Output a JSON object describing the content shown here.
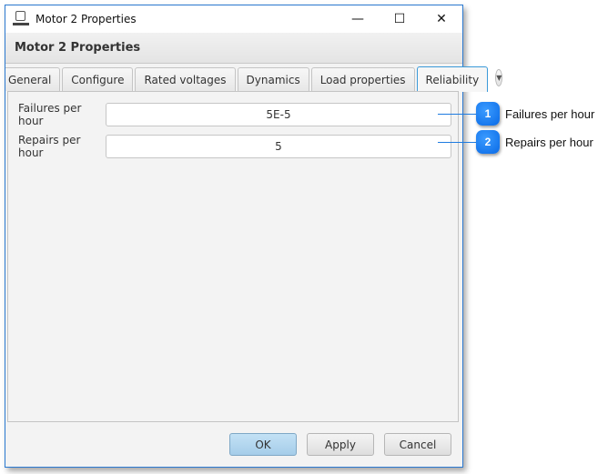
{
  "window": {
    "title": "Motor 2 Properties",
    "controls": {
      "minimize": "—",
      "maximize": "☐",
      "close": "✕"
    }
  },
  "header": {
    "title": "Motor 2 Properties"
  },
  "tabs": [
    {
      "label": "General",
      "active": false
    },
    {
      "label": "Configure",
      "active": false
    },
    {
      "label": "Rated voltages",
      "active": false
    },
    {
      "label": "Dynamics",
      "active": false
    },
    {
      "label": "Load properties",
      "active": false
    },
    {
      "label": "Reliability",
      "active": true
    }
  ],
  "tab_overflow_icon": "▼",
  "fields": [
    {
      "label": "Failures per hour",
      "value": "5E-5"
    },
    {
      "label": "Repairs per hour",
      "value": "5"
    }
  ],
  "buttons": {
    "ok": "OK",
    "apply": "Apply",
    "cancel": "Cancel"
  },
  "callouts": [
    {
      "number": "1",
      "text": "Failures per hour"
    },
    {
      "number": "2",
      "text": "Repairs per hour"
    }
  ],
  "colors": {
    "accent": "#2b79d0",
    "callout": "#0a6ae6",
    "default_button": "#a5cde9"
  }
}
